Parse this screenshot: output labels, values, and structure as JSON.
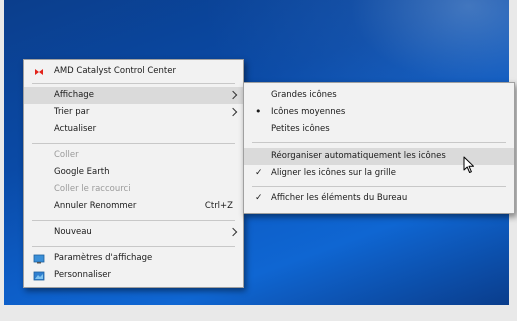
{
  "context_menu": {
    "amd": "AMD Catalyst Control Center",
    "affichage": "Affichage",
    "trier_par": "Trier par",
    "actualiser": "Actualiser",
    "coller": "Coller",
    "google_earth": "Google Earth",
    "coller_raccourci": "Coller le raccourci",
    "annuler": "Annuler Renommer",
    "annuler_shortcut": "Ctrl+Z",
    "nouveau": "Nouveau",
    "parametres": "Paramètres d'affichage",
    "personnaliser": "Personnaliser"
  },
  "submenu": {
    "grandes": "Grandes icônes",
    "moyennes": "Icônes moyennes",
    "petites": "Petites icônes",
    "reorganiser": "Réorganiser automatiquement les icônes",
    "aligner": "Aligner les icônes sur la grille",
    "afficher": "Afficher les éléments du Bureau"
  },
  "colors": {
    "desktop_blue": "#0b52b8",
    "menu_bg": "#f2f2f2",
    "highlight": "#dadada",
    "amd_red": "#e2231a"
  },
  "state": {
    "view_selected": "Icônes moyennes",
    "checked": [
      "Aligner les icônes sur la grille",
      "Afficher les éléments du Bureau"
    ],
    "hovered_main": "Affichage",
    "hovered_sub": "Réorganiser automatiquement les icônes"
  }
}
